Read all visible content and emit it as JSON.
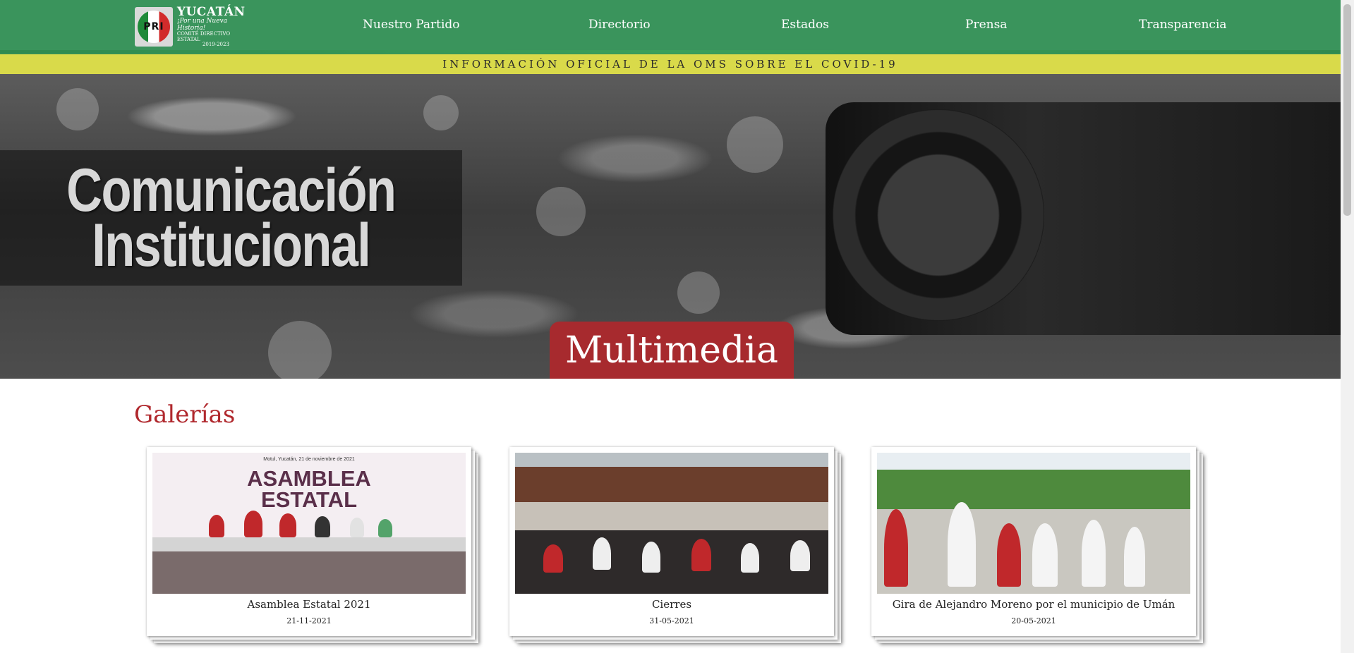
{
  "header": {
    "logo": {
      "emblem": "PRI",
      "title": "YUCATÁN",
      "slogan": "¡Por una Nueva Historia!",
      "subtitle": "COMITÉ DIRECTIVO ESTATAL",
      "years": "2019-2023"
    },
    "nav": [
      {
        "label": "Nuestro Partido"
      },
      {
        "label": "Directorio"
      },
      {
        "label": "Estados"
      },
      {
        "label": "Prensa"
      },
      {
        "label": "Transparencia"
      }
    ]
  },
  "covid_banner": "INFORMACIÓN OFICIAL DE LA OMS SOBRE EL COVID-19",
  "hero": {
    "title_line1": "Comunicación",
    "title_line2": "Institucional",
    "section_tab": "Multimedia"
  },
  "galleries": {
    "heading": "Galerías",
    "items": [
      {
        "title": "Asamblea Estatal 2021",
        "date": "21-11-2021",
        "photo_caption": "Motul, Yucatán, 21 de noviembre de 2021",
        "photo_heading_line1": "ASAMBLEA",
        "photo_heading_line2": "ESTATAL"
      },
      {
        "title": "Cierres",
        "date": "31-05-2021"
      },
      {
        "title": "Gira de Alejandro Moreno por el municipio de Umán",
        "date": "20-05-2021"
      }
    ]
  },
  "colors": {
    "header_green": "#3a945c",
    "banner_yellow": "#d9da4a",
    "accent_red": "#b0282d",
    "tab_red": "#a72a2e"
  }
}
